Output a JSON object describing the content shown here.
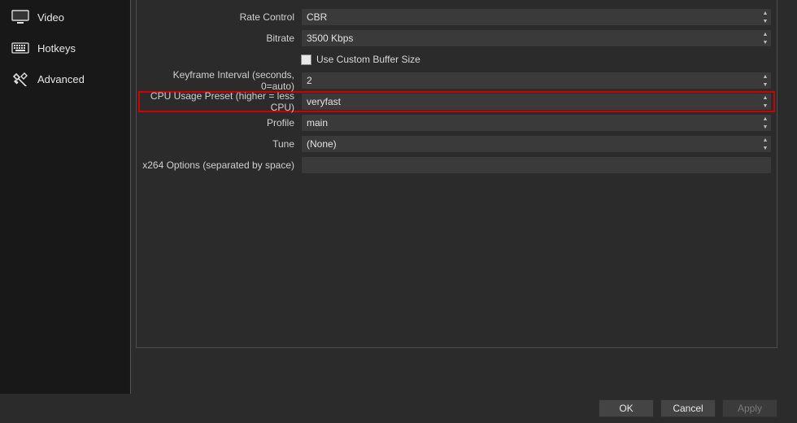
{
  "sidebar": {
    "items": [
      {
        "id": "video",
        "label": "Video",
        "icon": "monitor"
      },
      {
        "id": "hotkeys",
        "label": "Hotkeys",
        "icon": "keyboard"
      },
      {
        "id": "advanced",
        "label": "Advanced",
        "icon": "wrench"
      }
    ]
  },
  "form": {
    "rate_control": {
      "label": "Rate Control",
      "value": "CBR"
    },
    "bitrate": {
      "label": "Bitrate",
      "value": "3500 Kbps"
    },
    "use_custom_buffer": {
      "label": "Use Custom Buffer Size",
      "checked": false
    },
    "keyframe_interval": {
      "label": "Keyframe Interval (seconds, 0=auto)",
      "value": "2"
    },
    "cpu_preset": {
      "label": "CPU Usage Preset (higher = less CPU)",
      "value": "veryfast"
    },
    "profile": {
      "label": "Profile",
      "value": "main"
    },
    "tune": {
      "label": "Tune",
      "value": "(None)"
    },
    "x264_options": {
      "label": "x264 Options (separated by space)",
      "value": ""
    }
  },
  "highlighted_row": "cpu_preset",
  "buttons": {
    "ok": "OK",
    "cancel": "Cancel",
    "apply": "Apply"
  }
}
